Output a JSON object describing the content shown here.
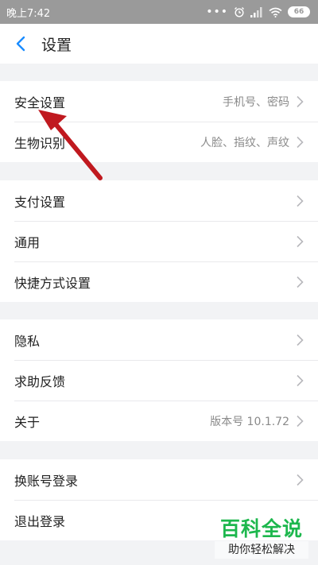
{
  "status_bar": {
    "time": "晚上7:42",
    "dots": "•••",
    "battery": "66",
    "icons": [
      "alarm-icon",
      "signal-icon",
      "wifi-icon",
      "battery-icon"
    ]
  },
  "header": {
    "title": "设置"
  },
  "groups": [
    [
      {
        "label": "安全设置",
        "hint": "手机号、密码"
      },
      {
        "label": "生物识别",
        "hint": "人脸、指纹、声纹"
      }
    ],
    [
      {
        "label": "支付设置",
        "hint": ""
      },
      {
        "label": "通用",
        "hint": ""
      },
      {
        "label": "快捷方式设置",
        "hint": ""
      }
    ],
    [
      {
        "label": "隐私",
        "hint": ""
      },
      {
        "label": "求助反馈",
        "hint": ""
      },
      {
        "label": "关于",
        "hint": "版本号 10.1.72"
      }
    ],
    [
      {
        "label": "换账号登录",
        "hint": ""
      },
      {
        "label": "退出登录",
        "hint": ""
      }
    ]
  ],
  "watermark": {
    "title": "百科全说",
    "subtitle": "助你轻松解决"
  },
  "colors": {
    "accent": "#1a8cff",
    "arrow": "#c0191f",
    "watermark": "#1db74d",
    "statusbar": "#9a9a9a",
    "background": "#f2f3f5"
  }
}
